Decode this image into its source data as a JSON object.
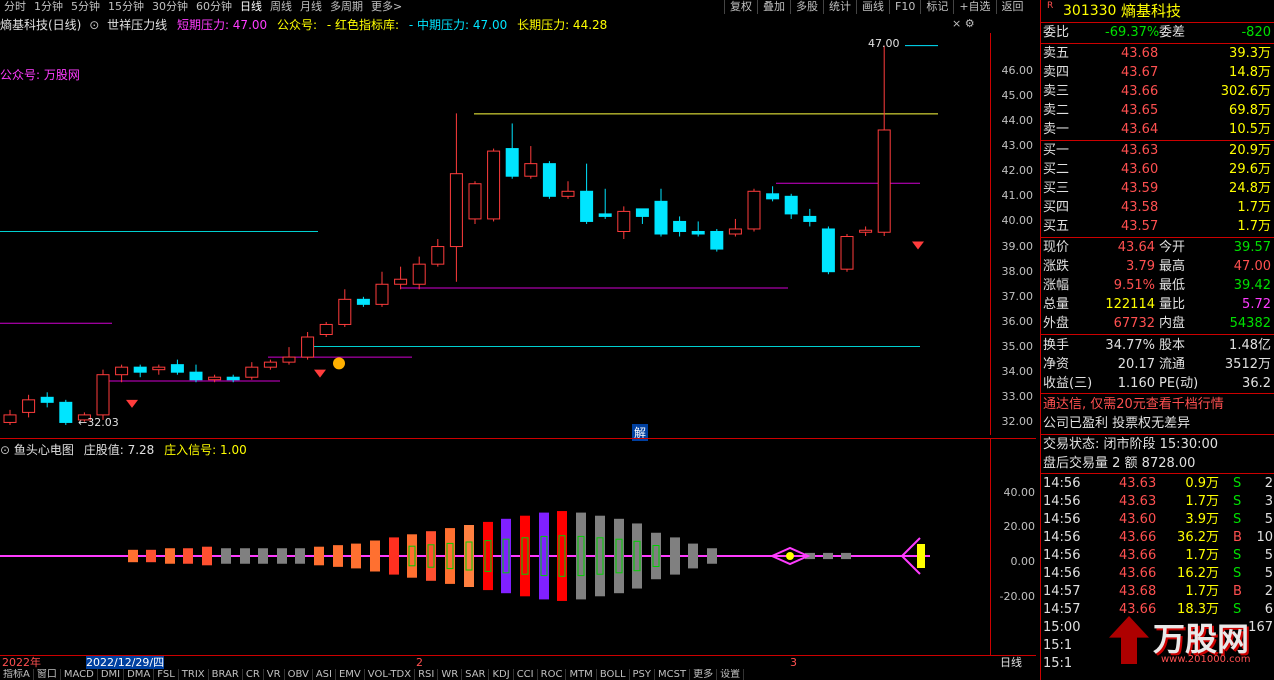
{
  "toolbar": {
    "periods": [
      "分时",
      "1分钟",
      "5分钟",
      "15分钟",
      "30分钟",
      "60分钟",
      "日线",
      "周线",
      "月线",
      "多周期",
      "更多>"
    ],
    "selected": "日线",
    "right": [
      "复权",
      "叠加",
      "多股",
      "统计",
      "画线",
      "F10",
      "标记",
      "+自选",
      "返回"
    ]
  },
  "info": {
    "title": "熵基科技(日线)",
    "indicator": "世祥压力线",
    "short_label": "短期压力: 47.00",
    "gzh_label": "公众号:",
    "red_label": "- 红色指标库:",
    "mid_label": "- 中期压力: 47.00",
    "long_label": "长期压力: 44.28",
    "watermark": "公众号: 万股网"
  },
  "price_axis": [
    "46.00",
    "45.00",
    "44.00",
    "43.00",
    "42.00",
    "41.00",
    "40.00",
    "39.00",
    "38.00",
    "37.00",
    "36.00",
    "35.00",
    "34.00",
    "33.00",
    "32.00"
  ],
  "annotations": {
    "high": "47.00",
    "low": "32.03",
    "jie": "解"
  },
  "lower": {
    "title": "鱼头心电图",
    "zhuang": "庄股值: 7.28",
    "signal": "庄入信号: 1.00",
    "axis": [
      "40.00",
      "20.00",
      "0.00",
      "-20.00"
    ]
  },
  "timeline": {
    "year": "2022年",
    "date": "2022/12/29/四",
    "m2": "2",
    "m3": "3",
    "period": "日线"
  },
  "indicator_tabs": [
    "指标A",
    "窗口",
    "MACD",
    "DMI",
    "DMA",
    "FSL",
    "TRIX",
    "BRAR",
    "CR",
    "VR",
    "OBV",
    "ASI",
    "EMV",
    "VOL-TDX",
    "RSI",
    "WR",
    "SAR",
    "KDJ",
    "CCI",
    "ROC",
    "MTM",
    "BOLL",
    "PSY",
    "MCST",
    "更多",
    "设置"
  ],
  "quote": {
    "code": "301330",
    "name": "熵基科技",
    "weibi": {
      "label": "委比",
      "value": "-69.37%",
      "label2": "委差",
      "value2": "-820"
    },
    "asks": [
      {
        "label": "卖五",
        "price": "43.68",
        "vol": "39.3万"
      },
      {
        "label": "卖四",
        "price": "43.67",
        "vol": "14.8万"
      },
      {
        "label": "卖三",
        "price": "43.66",
        "vol": "302.6万"
      },
      {
        "label": "卖二",
        "price": "43.65",
        "vol": "69.8万"
      },
      {
        "label": "卖一",
        "price": "43.64",
        "vol": "10.5万"
      }
    ],
    "bids": [
      {
        "label": "买一",
        "price": "43.63",
        "vol": "20.9万"
      },
      {
        "label": "买二",
        "price": "43.60",
        "vol": "29.6万"
      },
      {
        "label": "买三",
        "price": "43.59",
        "vol": "24.8万"
      },
      {
        "label": "买四",
        "price": "43.58",
        "vol": "1.7万"
      },
      {
        "label": "买五",
        "price": "43.57",
        "vol": "1.7万"
      }
    ],
    "stats": [
      {
        "l1": "现价",
        "v1": "43.64",
        "l2": "今开",
        "v2": "39.57",
        "c1": "red",
        "c2": "green"
      },
      {
        "l1": "涨跌",
        "v1": "3.79",
        "l2": "最高",
        "v2": "47.00",
        "c1": "red",
        "c2": "red"
      },
      {
        "l1": "涨幅",
        "v1": "9.51%",
        "l2": "最低",
        "v2": "39.42",
        "c1": "red",
        "c2": "green"
      },
      {
        "l1": "总量",
        "v1": "122114",
        "l2": "量比",
        "v2": "5.72",
        "c1": "yel",
        "c2": "mag"
      },
      {
        "l1": "外盘",
        "v1": "67732",
        "l2": "内盘",
        "v2": "54382",
        "c1": "red",
        "c2": "green"
      }
    ],
    "stats2": [
      {
        "l1": "换手",
        "v1": "34.77%",
        "l2": "股本",
        "v2": "1.48亿"
      },
      {
        "l1": "净资",
        "v1": "20.17",
        "l2": "流通",
        "v2": "3512万"
      },
      {
        "l1": "收益(三)",
        "v1": "1.160",
        "l2": "PE(动)",
        "v2": "36.2"
      }
    ],
    "ad": "通达信, 仅需20元查看千档行情",
    "ad2": "公司已盈利 投票权无差异",
    "trade_state": "交易状态: 闭市阶段 15:30:00",
    "after_hours": "盘后交易量 2 额 8728.00",
    "ticks": [
      {
        "t": "14:56",
        "p": "43.63",
        "v": "0.9万",
        "s": "S",
        "n": "2"
      },
      {
        "t": "14:56",
        "p": "43.63",
        "v": "1.7万",
        "s": "S",
        "n": "3"
      },
      {
        "t": "14:56",
        "p": "43.60",
        "v": "3.9万",
        "s": "S",
        "n": "5"
      },
      {
        "t": "14:56",
        "p": "43.66",
        "v": "36.2万",
        "s": "B",
        "n": "10"
      },
      {
        "t": "14:56",
        "p": "43.66",
        "v": "1.7万",
        "s": "S",
        "n": "5"
      },
      {
        "t": "14:56",
        "p": "43.66",
        "v": "16.2万",
        "s": "S",
        "n": "5"
      },
      {
        "t": "14:57",
        "p": "43.68",
        "v": "1.7万",
        "s": "B",
        "n": "2"
      },
      {
        "t": "14:57",
        "p": "43.66",
        "v": "18.3万",
        "s": "S",
        "n": "6"
      },
      {
        "t": "15:00",
        "p": "",
        "v": "",
        "s": "",
        "n": "167"
      },
      {
        "t": "15:1",
        "p": "",
        "v": "",
        "s": "",
        "n": ""
      },
      {
        "t": "15:1",
        "p": "",
        "v": "",
        "s": "",
        "n": ""
      }
    ],
    "logo": "万股网",
    "logo_url": "www.201000.com"
  },
  "chart_data": {
    "type": "candlestick",
    "ylim": [
      31.5,
      47.5
    ],
    "candles": [
      [
        32.0,
        32.3,
        32.5,
        31.9
      ],
      [
        32.4,
        32.9,
        33.1,
        32.2
      ],
      [
        33.0,
        32.8,
        33.2,
        32.6
      ],
      [
        32.8,
        32.0,
        32.9,
        31.9
      ],
      [
        32.1,
        32.3,
        32.4,
        32.03
      ],
      [
        32.3,
        33.9,
        34.1,
        32.1
      ],
      [
        33.9,
        34.2,
        34.3,
        33.6
      ],
      [
        34.2,
        34.0,
        34.3,
        33.8
      ],
      [
        34.1,
        34.2,
        34.3,
        33.9
      ],
      [
        34.3,
        34.0,
        34.5,
        33.9
      ],
      [
        34.0,
        33.7,
        34.3,
        33.6
      ],
      [
        33.7,
        33.8,
        33.9,
        33.6
      ],
      [
        33.8,
        33.7,
        33.9,
        33.6
      ],
      [
        33.8,
        34.2,
        34.4,
        33.7
      ],
      [
        34.2,
        34.4,
        34.5,
        34.1
      ],
      [
        34.4,
        34.6,
        35.0,
        34.3
      ],
      [
        34.6,
        35.4,
        35.6,
        34.5
      ],
      [
        35.5,
        35.9,
        36.0,
        35.4
      ],
      [
        35.9,
        36.9,
        37.3,
        35.8
      ],
      [
        36.9,
        36.7,
        37.0,
        36.6
      ],
      [
        36.7,
        37.5,
        38.0,
        36.6
      ],
      [
        37.5,
        37.7,
        38.2,
        37.3
      ],
      [
        37.5,
        38.3,
        38.6,
        37.3
      ],
      [
        38.3,
        39.0,
        39.3,
        38.2
      ],
      [
        39.0,
        41.9,
        44.3,
        37.6
      ],
      [
        40.1,
        41.5,
        41.6,
        39.9
      ],
      [
        40.1,
        42.8,
        42.9,
        40.0
      ],
      [
        42.9,
        41.8,
        43.9,
        41.7
      ],
      [
        41.8,
        42.3,
        43.0,
        41.7
      ],
      [
        42.3,
        41.0,
        42.4,
        40.9
      ],
      [
        41.0,
        41.2,
        41.6,
        40.9
      ],
      [
        41.2,
        40.0,
        42.3,
        39.9
      ],
      [
        40.3,
        40.2,
        41.3,
        40.1
      ],
      [
        39.6,
        40.4,
        40.6,
        39.3
      ],
      [
        40.5,
        40.2,
        40.5,
        39.9
      ],
      [
        40.8,
        39.5,
        41.3,
        39.4
      ],
      [
        40.0,
        39.6,
        40.2,
        39.4
      ],
      [
        39.6,
        39.5,
        40.0,
        39.4
      ],
      [
        39.6,
        38.9,
        39.7,
        38.8
      ],
      [
        39.5,
        39.7,
        40.1,
        39.4
      ],
      [
        39.7,
        41.2,
        41.3,
        39.6
      ],
      [
        41.1,
        40.9,
        41.4,
        40.8
      ],
      [
        41.0,
        40.3,
        41.1,
        40.1
      ],
      [
        40.2,
        40.0,
        40.5,
        39.8
      ],
      [
        39.7,
        38.0,
        39.8,
        37.9
      ],
      [
        38.1,
        39.4,
        39.5,
        38.0
      ],
      [
        39.57,
        39.65,
        39.8,
        39.42
      ],
      [
        39.57,
        43.64,
        47.0,
        39.42
      ]
    ]
  }
}
